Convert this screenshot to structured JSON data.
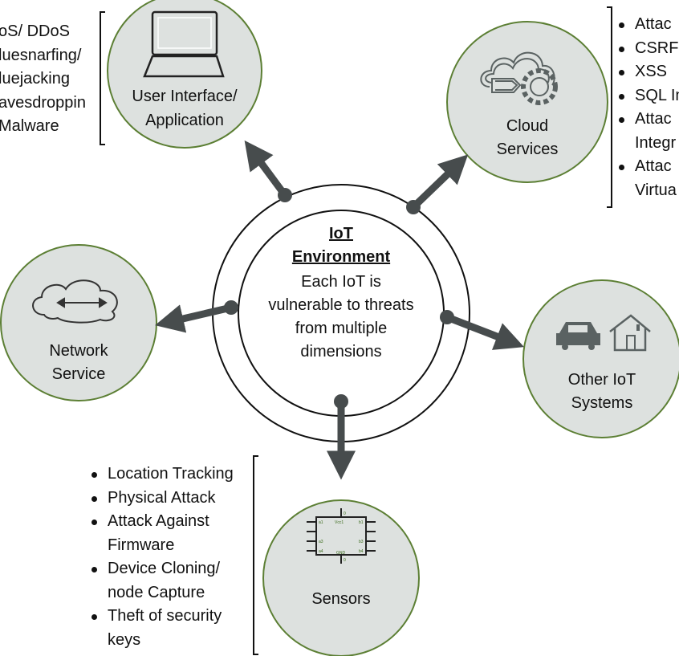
{
  "colors": {
    "node_fill": "#dde1df",
    "node_border": "#5c7f34",
    "arrow": "#474c4d"
  },
  "center": {
    "title_line1": "IoT",
    "title_line2": "Environment",
    "body": [
      "Each IoT is",
      "vulnerable to threats",
      "from multiple",
      "dimensions"
    ]
  },
  "nodes": {
    "ui": {
      "label": [
        "User Interface/",
        "Application"
      ],
      "icon": "laptop-icon",
      "threats": [
        "oS/ DDoS",
        "luesnarfing/",
        "luejacking",
        "avesdroppin",
        "Malware"
      ]
    },
    "cloud": {
      "label": [
        "Cloud",
        "Services"
      ],
      "icon": "cloud-gear-icon",
      "threats": [
        "Attac",
        "CSRF",
        "XSS",
        "SQL In",
        "Attac",
        "Integr",
        "Attac",
        "Virtua"
      ]
    },
    "network": {
      "label": [
        "Network",
        "Service"
      ],
      "icon": "cloud-arrows-icon"
    },
    "other": {
      "label": [
        "Other IoT",
        "Systems"
      ],
      "icon": "car-house-icon"
    },
    "sensors": {
      "label": [
        "Sensors"
      ],
      "icon": "chip-icon",
      "chip_labels": {
        "vcc": "Vcc1",
        "gnd": "GND",
        "top": "0",
        "bottom": "0"
      },
      "threats": [
        "Location Tracking",
        "Physical Attack",
        "Attack Against",
        "Firmware",
        "Device Cloning/",
        "node Capture",
        "Theft of security",
        "keys"
      ]
    }
  }
}
